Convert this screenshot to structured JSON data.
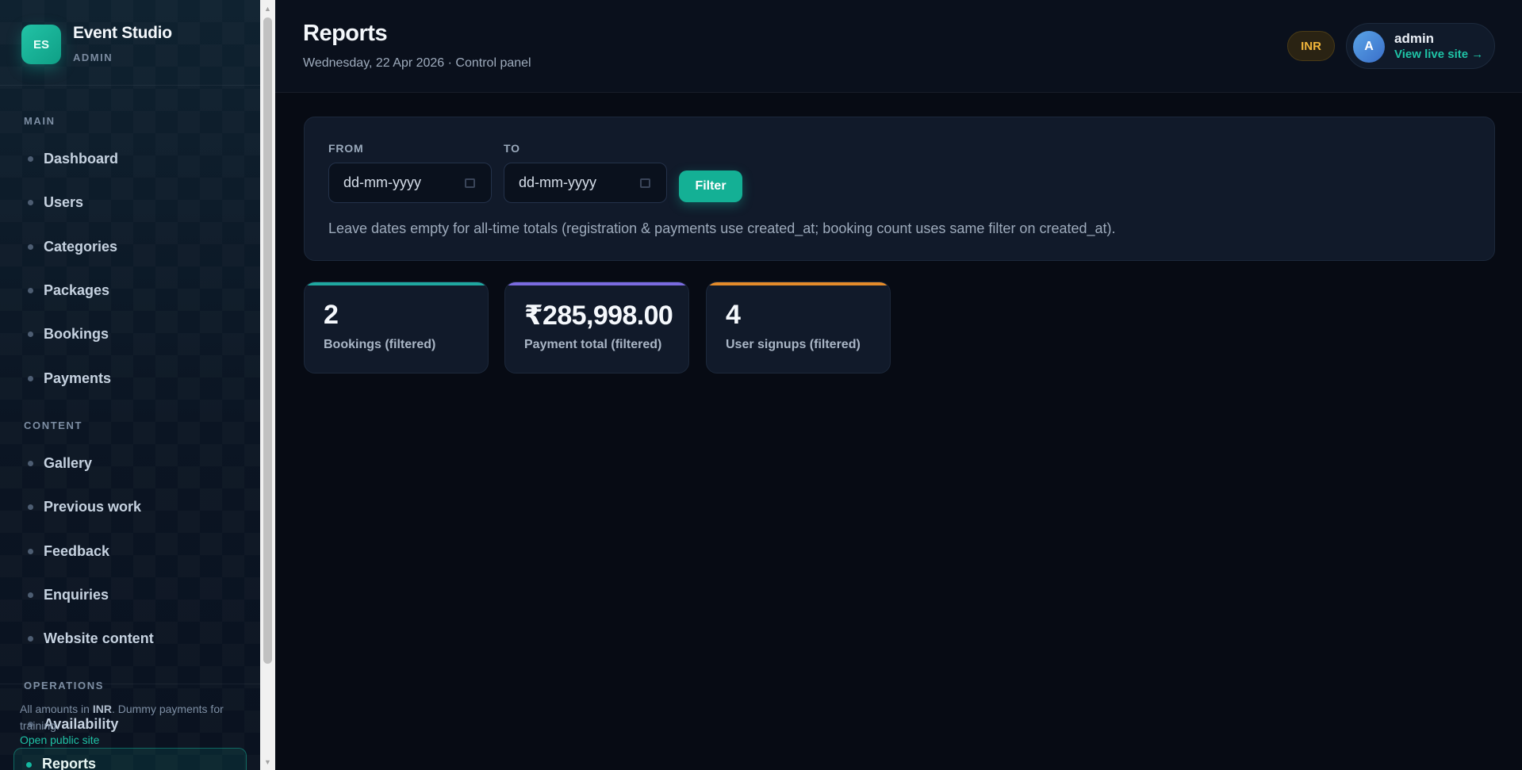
{
  "brand": {
    "logo": "ES",
    "name": "Event Studio",
    "sub": "ADMIN"
  },
  "sidebar": {
    "sections": [
      {
        "title": "MAIN"
      },
      {
        "title": "CONTENT"
      },
      {
        "title": "OPERATIONS"
      }
    ],
    "items": [
      {
        "label": "Dashboard"
      },
      {
        "label": "Users"
      },
      {
        "label": "Categories"
      },
      {
        "label": "Packages"
      },
      {
        "label": "Bookings"
      },
      {
        "label": "Payments"
      },
      {
        "label": "Gallery"
      },
      {
        "label": "Previous work"
      },
      {
        "label": "Feedback"
      },
      {
        "label": "Enquiries"
      },
      {
        "label": "Website content"
      },
      {
        "label": "Availability"
      },
      {
        "label": "Reports",
        "active": true
      }
    ],
    "footer": {
      "prefix": "All amounts in ",
      "currency": "INR",
      "suffix": ". Dummy payments for training.",
      "link": "Open public site"
    }
  },
  "header": {
    "title": "Reports",
    "subtitle": "Wednesday, 22 Apr 2026 · Control panel",
    "currency_badge": "INR",
    "user": {
      "avatar": "A",
      "name": "admin",
      "link": "View live site →"
    }
  },
  "filter": {
    "from_label": "FROM",
    "from_value": "dd-mm-yyyy",
    "to_label": "TO",
    "to_value": "dd-mm-yyyy",
    "button": "Filter",
    "hint": "Leave dates empty for all-time totals (registration & payments use created_at; booking count uses same filter on created_at)."
  },
  "stats": [
    {
      "value": "2",
      "label": "Bookings (filtered)",
      "accent": "#1fa8a0"
    },
    {
      "value": "₹285,998.00",
      "label": "Payment total (filtered)",
      "accent": "#7b6be0"
    },
    {
      "value": "4",
      "label": "User signups (filtered)",
      "accent": "#e48b2a"
    }
  ],
  "colors": {
    "accent": "#14b8a0",
    "background": "#070b14",
    "card": "#111a2a",
    "badge": "#f0b53a"
  },
  "icons": {
    "calendar": "calendar-icon",
    "nav_bullet": "dot-icon"
  }
}
